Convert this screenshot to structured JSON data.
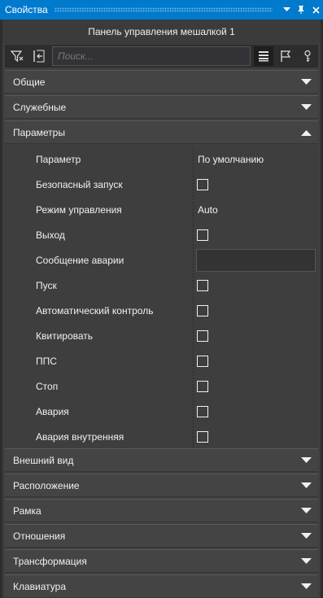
{
  "window": {
    "title": "Свойства"
  },
  "header": {
    "title": "Панель управления мешалкой 1"
  },
  "toolbar": {
    "search_placeholder": "Поиск..."
  },
  "sections_top": [
    {
      "label": "Общие",
      "expanded": false
    },
    {
      "label": "Служебные",
      "expanded": false
    },
    {
      "label": "Параметры",
      "expanded": true
    }
  ],
  "parameters": {
    "header_name": "Параметр",
    "header_value": "По умолчанию",
    "rows": [
      {
        "name": "Безопасный запуск",
        "type": "checkbox",
        "checked": false
      },
      {
        "name": "Режим управления",
        "type": "text",
        "value": "Auto"
      },
      {
        "name": "Выход",
        "type": "checkbox",
        "checked": false
      },
      {
        "name": "Сообщение аварии",
        "type": "input",
        "value": ""
      },
      {
        "name": "Пуск",
        "type": "checkbox",
        "checked": false
      },
      {
        "name": "Автоматический контроль",
        "type": "checkbox",
        "checked": false
      },
      {
        "name": "Квитировать",
        "type": "checkbox",
        "checked": false
      },
      {
        "name": "ППС",
        "type": "checkbox",
        "checked": false
      },
      {
        "name": "Стоп",
        "type": "checkbox",
        "checked": false
      },
      {
        "name": "Авария",
        "type": "checkbox",
        "checked": false
      },
      {
        "name": "Авария внутренняя",
        "type": "checkbox",
        "checked": false
      }
    ]
  },
  "sections_bottom": [
    {
      "label": "Внешний вид",
      "expanded": false
    },
    {
      "label": "Расположение",
      "expanded": false
    },
    {
      "label": "Рамка",
      "expanded": false
    },
    {
      "label": "Отношения",
      "expanded": false
    },
    {
      "label": "Трансформация",
      "expanded": false
    },
    {
      "label": "Клавиатура",
      "expanded": false
    }
  ],
  "colors": {
    "accent": "#007acc",
    "panel": "#3f3f3f",
    "section": "#444444"
  }
}
